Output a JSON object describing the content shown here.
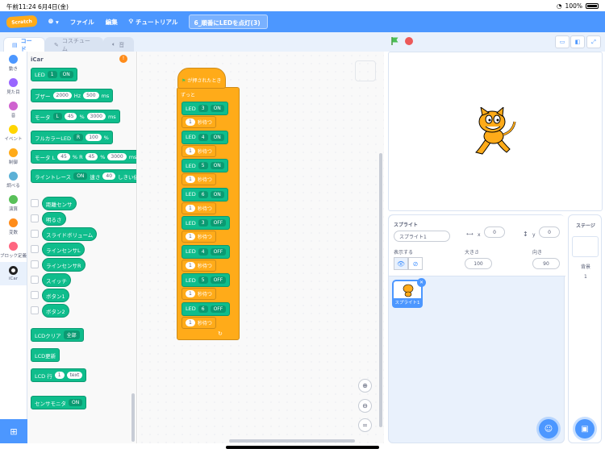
{
  "status": {
    "time": "午前11:24",
    "date": "6月4日(金)",
    "battery": "100%"
  },
  "menu": {
    "logo": "Scratch",
    "file": "ファイル",
    "edit": "編集",
    "tutorial": "チュートリアル",
    "project_title": "6_順番にLEDを点灯(3)"
  },
  "tabs": {
    "code": "コード",
    "costume": "コスチューム",
    "sound": "音"
  },
  "categories": [
    {
      "label": "動き",
      "color": "#4c97ff"
    },
    {
      "label": "見た目",
      "color": "#9966ff"
    },
    {
      "label": "音",
      "color": "#cf63cf"
    },
    {
      "label": "イベント",
      "color": "#ffd500"
    },
    {
      "label": "制御",
      "color": "#ffab19"
    },
    {
      "label": "調べる",
      "color": "#5cb1d6"
    },
    {
      "label": "演算",
      "color": "#59c059"
    },
    {
      "label": "変数",
      "color": "#ff8c1a"
    },
    {
      "label": "ブロック定義",
      "color": "#ff6680"
    },
    {
      "label": "iCar",
      "color": "#222222"
    }
  ],
  "palette": {
    "title": "iCar",
    "led": {
      "label": "LED",
      "num": "1",
      "state": "ON"
    },
    "buzzer": {
      "label": "ブザー",
      "hz": "2000",
      "hz_unit": "Hz",
      "ms": "500",
      "ms_unit": "ms"
    },
    "motor": {
      "label": "モータ",
      "side": "L",
      "pct": "45",
      "pct_unit": "%",
      "ms": "3000",
      "ms_unit": "ms"
    },
    "fullcolor": {
      "label": "フルカラーLED",
      "color": "R",
      "pct": "100",
      "pct_unit": "%"
    },
    "motor2": {
      "label": "モータ L",
      "l": "45",
      "mid": "% R",
      "r": "45",
      "pct_unit": "%",
      "ms": "3000",
      "ms_unit": "ms"
    },
    "linetrace": {
      "label": "ライントレース",
      "state": "ON",
      "speed_label": "速さ",
      "speed": "40",
      "threshold": "しきい値"
    },
    "reporters": [
      "距離センサ",
      "明るさ",
      "スライドボリューム",
      "ラインセンサL",
      "ラインセンサR",
      "スイッチ",
      "ボタン1",
      "ボタン2"
    ],
    "lcd_clear": {
      "label": "LCDクリア",
      "opt": "全部"
    },
    "lcd_update": "LCD更新",
    "lcd_line": {
      "label": "LCD 行",
      "num": "1",
      "text": "text"
    },
    "sensor_monitor": {
      "label": "センサモニタ",
      "state": "ON"
    }
  },
  "script": {
    "hat": "が押されたとき",
    "forever": "ずっと",
    "steps": [
      {
        "led": "LED",
        "num": "3",
        "state": "ON",
        "wait": "1",
        "wait_label": "秒待つ"
      },
      {
        "led": "LED",
        "num": "4",
        "state": "ON",
        "wait": "1",
        "wait_label": "秒待つ"
      },
      {
        "led": "LED",
        "num": "5",
        "state": "ON",
        "wait": "1",
        "wait_label": "秒待つ"
      },
      {
        "led": "LED",
        "num": "6",
        "state": "ON",
        "wait": "1",
        "wait_label": "秒待つ"
      },
      {
        "led": "LED",
        "num": "3",
        "state": "OFF",
        "wait": "1",
        "wait_label": "秒待つ"
      },
      {
        "led": "LED",
        "num": "4",
        "state": "OFF",
        "wait": "1",
        "wait_label": "秒待つ"
      },
      {
        "led": "LED",
        "num": "5",
        "state": "OFF",
        "wait": "1",
        "wait_label": "秒待つ"
      },
      {
        "led": "LED",
        "num": "6",
        "state": "OFF",
        "wait": "1",
        "wait_label": "秒待つ"
      }
    ]
  },
  "sprite": {
    "title": "スプライト",
    "name": "スプライト1",
    "x_label": "x",
    "x": "0",
    "y_label": "y",
    "y": "0",
    "show_label": "表示する",
    "size_label": "大きさ",
    "size": "100",
    "dir_label": "向き",
    "dir": "90",
    "thumb_label": "スプライト1"
  },
  "stage_pane": {
    "title": "ステージ",
    "bg_label": "背景",
    "bg_count": "1"
  },
  "colors": {
    "accent": "#4c97ff",
    "looks_green": "#0fbd8c",
    "control": "#ffab19"
  }
}
